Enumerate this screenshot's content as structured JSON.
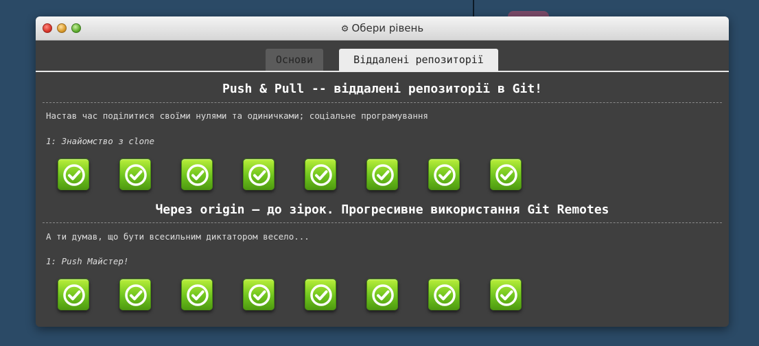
{
  "window": {
    "title": "Обери рівень",
    "title_icon": "gear-icon"
  },
  "tabs": [
    {
      "label": "Основи",
      "active": false
    },
    {
      "label": "Віддалені репозиторії",
      "active": true
    }
  ],
  "sections": [
    {
      "title": "Push & Pull -- віддалені репозиторії в Git!",
      "description": "Настав час поділитися своїми нулями та одиничками; соціальне програмування",
      "level_label": "1: Знайомство з clone",
      "levels_completed": [
        true,
        true,
        true,
        true,
        true,
        true,
        true,
        true
      ]
    },
    {
      "title": "Через origin – до зірок. Прогресивне використання Git Remotes",
      "description": "А ти думав, що бути всесильним диктатором весело...",
      "level_label": "1: Push Майстер!",
      "levels_completed": [
        true,
        true,
        true,
        true,
        true,
        true,
        true,
        true
      ]
    }
  ],
  "colors": {
    "desktop": "#2b4a66",
    "window_body": "#3f3f3f",
    "level_complete": "#6fc41e"
  }
}
